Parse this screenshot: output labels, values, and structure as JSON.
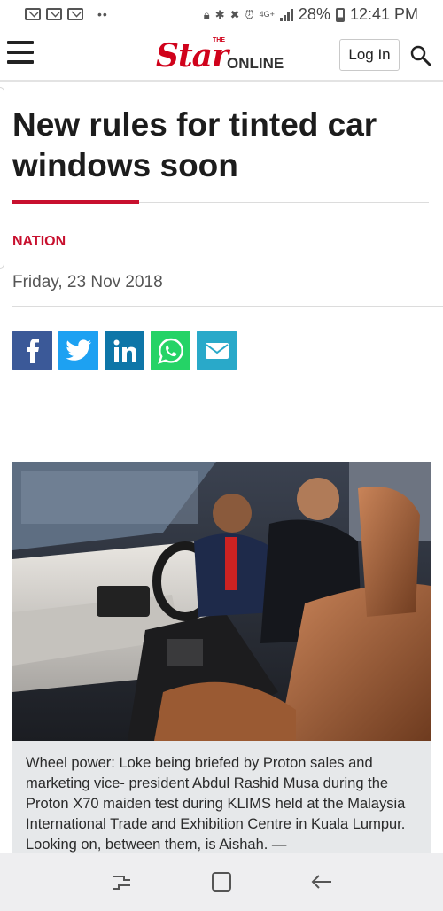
{
  "status_bar": {
    "battery": "28%",
    "time": "12:41 PM",
    "network": "4G+"
  },
  "header": {
    "logo_the": "THE",
    "logo_star": "Star",
    "logo_online": "ONLINE",
    "login_label": "Log In",
    "brand_color": "#d0021b"
  },
  "article": {
    "headline": "New rules for tinted car windows soon",
    "section": "NATION",
    "date": "Friday, 23 Nov 2018",
    "share_buttons": [
      {
        "name": "facebook",
        "color": "#3b5998"
      },
      {
        "name": "twitter",
        "color": "#1da1f2"
      },
      {
        "name": "linkedin",
        "color": "#0e76a8"
      },
      {
        "name": "whatsapp",
        "color": "#25d366"
      },
      {
        "name": "email",
        "color": "#29a9c9"
      }
    ],
    "caption": "Wheel power: Loke being briefed by Proton sales and marketing vice- president Abdul Rashid Musa during the Proton X70 maiden test during KLIMS held at the Malaysia International Trade and Exhibition Centre in Kuala Lumpur. Looking on, between them, is Aishah. —"
  },
  "navigation_bar": {
    "buttons": [
      "recent-apps",
      "home",
      "back"
    ]
  }
}
